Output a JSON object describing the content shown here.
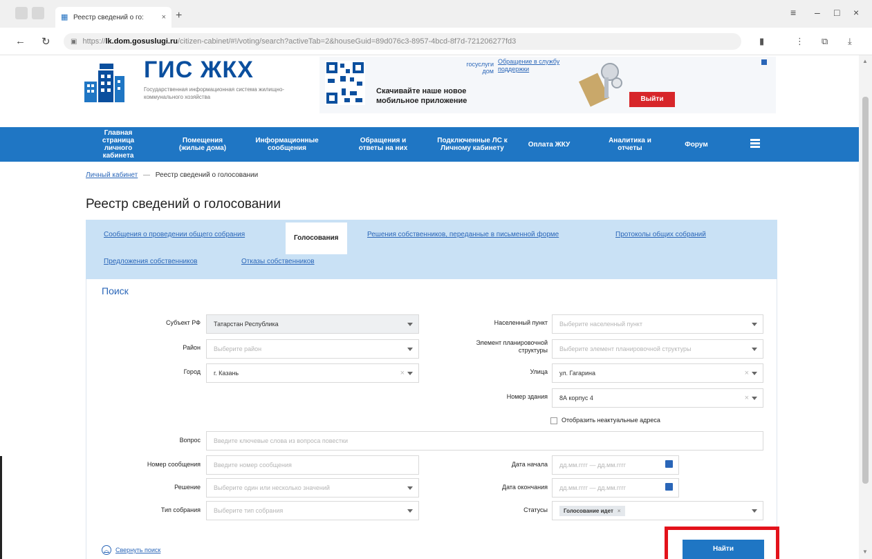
{
  "browser": {
    "tab_title": "Реестр сведений о го:",
    "tab_close": "×",
    "new_tab": "+",
    "url_prefix": "https://",
    "url_domain": "lk.dom.gosuslugi.ru",
    "url_rest": "/citizen-cabinet/#!/voting/search?activeTab=2&houseGuid=89d076c3-8957-4bcd-8f7d-721206277fd3"
  },
  "header": {
    "logo_title": "ГИС ЖКХ",
    "logo_subtitle": "Государственная информационная система жилищно-коммунального хозяйства",
    "gosuslugi": "госуслуги дом",
    "promo_text": "Скачивайте наше новое мобильное приложение",
    "support_link": "Обращение в службу поддержки",
    "logout": "Выйти"
  },
  "nav": [
    "Главная страница личного кабинета",
    "Помещения (жилые дома)",
    "Информационные сообщения",
    "Обращения и ответы на них",
    "Подключенные ЛС к Личному кабинету",
    "Оплата ЖКУ",
    "Аналитика и отчеты",
    "Форум"
  ],
  "breadcrumb": {
    "root": "Личный кабинет",
    "sep": "—",
    "current": "Реестр сведений о голосовании"
  },
  "page_title": "Реестр сведений о голосовании",
  "tabs": [
    "Сообщения о проведении общего собрания",
    "Голосования",
    "Решения собственников, переданные в письменной форме",
    "Протоколы общих собраний",
    "Предложения собственников",
    "Отказы собственников"
  ],
  "search": {
    "title": "Поиск",
    "subject_label": "Субъект РФ",
    "subject_value": "Татарстан Республика",
    "district_label": "Район",
    "district_placeholder": "Выберите район",
    "city_label": "Город",
    "city_value": "г. Казань",
    "locality_label": "Населенный пункт",
    "locality_placeholder": "Выберите населенный пункт",
    "planning_label": "Элемент планировочной структуры",
    "planning_placeholder": "Выберите элемент планировочной структуры",
    "street_label": "Улица",
    "street_value": "ул. Гагарина",
    "building_label": "Номер здания",
    "building_value": "8А корпус 4",
    "show_irrelevant": "Отобразить неактуальные адреса",
    "question_label": "Вопрос",
    "question_placeholder": "Введите ключевые слова из вопроса повестки",
    "msg_number_label": "Номер сообщения",
    "msg_number_placeholder": "Введите номер сообщения",
    "start_date_label": "Дата начала",
    "start_date_placeholder": "дд.мм.гггг — дд.мм.гггг",
    "decision_label": "Решение",
    "decision_placeholder": "Выберите один или несколько значений",
    "end_date_label": "Дата окончания",
    "end_date_placeholder": "дд.мм.гггг — дд.мм.гггг",
    "meeting_type_label": "Тип собрания",
    "meeting_type_placeholder": "Выберите тип собрания",
    "status_label": "Статусы",
    "status_chip": "Голосование идет",
    "collapse": "Свернуть поиск",
    "find": "Найти"
  },
  "colors": {
    "nav_blue": "#1f76c4",
    "logout_red": "#d7262a",
    "highlight_red": "#e3121b",
    "tabs_bg": "#c9e1f5"
  }
}
